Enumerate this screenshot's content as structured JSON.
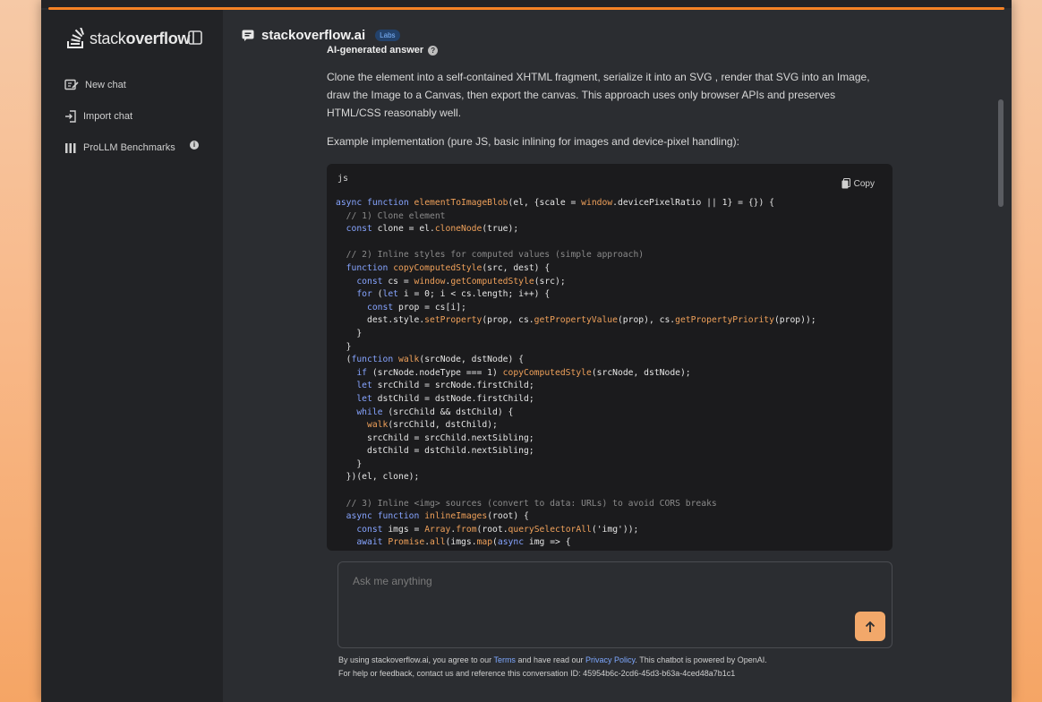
{
  "sidebar": {
    "logo_light": "stack",
    "logo_bold": "overflow",
    "items": [
      {
        "label": "New chat"
      },
      {
        "label": "Import chat"
      },
      {
        "label": "ProLLM Benchmarks"
      }
    ]
  },
  "header": {
    "brand": "stackoverflow.ai",
    "badge": "Labs"
  },
  "answer": {
    "heading": "AI-generated answer",
    "para1": "Clone the element into a self-contained XHTML fragment, serialize it into an SVG , render that SVG into an Image, draw the Image to a Canvas, then export the canvas. This approach uses only browser APIs and preserves HTML/CSS reasonably well.",
    "para2": "Example implementation (pure JS, basic inlining for images and device-pixel handling):"
  },
  "code": {
    "language": "js",
    "copy_label": "Copy",
    "lines": [
      "async function elementToImageBlob(el, {scale = window.devicePixelRatio || 1} = {}) {",
      "  // 1) Clone element",
      "  const clone = el.cloneNode(true);",
      "",
      "  // 2) Inline styles for computed values (simple approach)",
      "  function copyComputedStyle(src, dest) {",
      "    const cs = window.getComputedStyle(src);",
      "    for (let i = 0; i < cs.length; i++) {",
      "      const prop = cs[i];",
      "      dest.style.setProperty(prop, cs.getPropertyValue(prop), cs.getPropertyPriority(prop));",
      "    }",
      "  }",
      "  (function walk(srcNode, dstNode) {",
      "    if (srcNode.nodeType === 1) copyComputedStyle(srcNode, dstNode);",
      "    let srcChild = srcNode.firstChild;",
      "    let dstChild = dstNode.firstChild;",
      "    while (srcChild && dstChild) {",
      "      walk(srcChild, dstChild);",
      "      srcChild = srcChild.nextSibling;",
      "      dstChild = dstChild.nextSibling;",
      "    }",
      "  })(el, clone);",
      "",
      "  // 3) Inline <img> sources (convert to data: URLs) to avoid CORS breaks",
      "  async function inlineImages(root) {",
      "    const imgs = Array.from(root.querySelectorAll('img'));",
      "    await Promise.all(imgs.map(async img => {"
    ]
  },
  "composer": {
    "placeholder": "Ask me anything"
  },
  "footer": {
    "pre_terms": "By using stackoverflow.ai, you agree to our ",
    "terms": "Terms",
    "mid": " and have read our ",
    "privacy": "Privacy Policy",
    "post": ". This chatbot is powered by OpenAI.",
    "line2": "For help or feedback, contact us and reference this conversation ID: 45954b6c-2cd6-45d3-b63a-4ced48a7b1c1"
  },
  "colors": {
    "accent": "#f48225",
    "send_button": "#f2a86a",
    "link": "#7ea8ff"
  }
}
